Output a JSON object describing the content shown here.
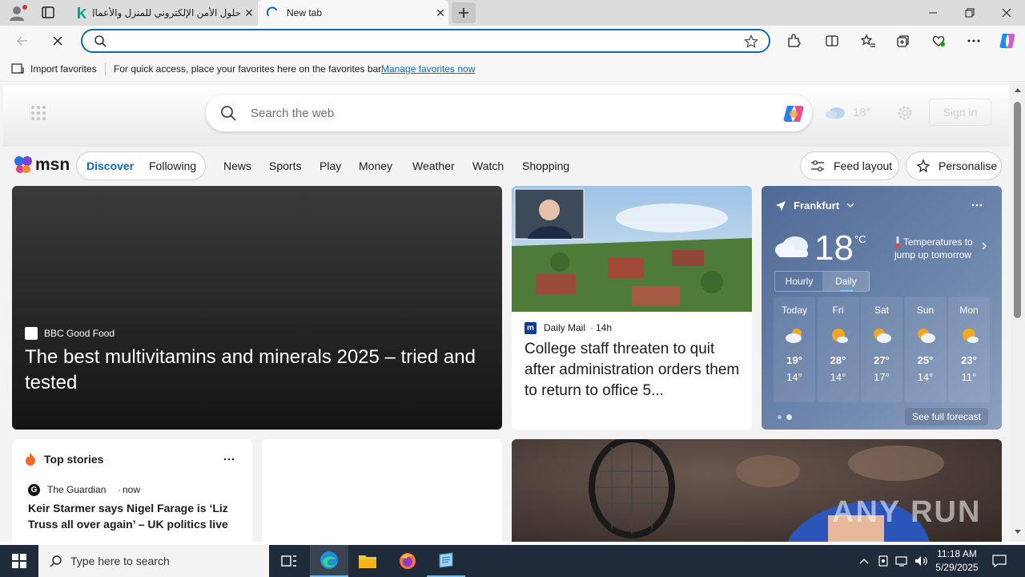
{
  "browser": {
    "tabs": [
      {
        "title": "حلول الأمن الإلكتروني للمنزل والأعمال",
        "icon": "kaspersky-k-icon"
      },
      {
        "title": "New tab",
        "icon": "loading-spinner-icon"
      }
    ],
    "address_value": "",
    "fav_import_label": "Import favorites",
    "fav_message": "For quick access, place your favorites here on the favorites bar.",
    "fav_manage_link": "Manage favorites now"
  },
  "newtab": {
    "search_placeholder": "Search the web",
    "weather_mini_temp": "18°",
    "sign_in_label": "Sign in"
  },
  "msn": {
    "logo_text": "msn",
    "pill_tabs": [
      "Discover",
      "Following"
    ],
    "nav_links": [
      "News",
      "Sports",
      "Play",
      "Money",
      "Weather",
      "Watch",
      "Shopping"
    ],
    "feed_layout_label": "Feed layout",
    "personalise_label": "Personalise"
  },
  "hero_article": {
    "source": "BBC Good Food",
    "headline": "The best multivitamins and minerals 2025 – tried and tested"
  },
  "second_article": {
    "source": "Daily Mail",
    "age": "14h",
    "headline": "College staff threaten to quit after administration orders them to return to office 5..."
  },
  "weather": {
    "location": "Frankfurt",
    "temp": "18",
    "unit": "°C",
    "alert": "Temperatures to jump up tomorrow",
    "toggle": [
      "Hourly",
      "Daily"
    ],
    "days": [
      {
        "day": "Today",
        "high": "19°",
        "low": "14°",
        "icon": "partly-cloudy-icon"
      },
      {
        "day": "Fri",
        "high": "28°",
        "low": "14°",
        "icon": "sunny-cloud-icon"
      },
      {
        "day": "Sat",
        "high": "27°",
        "low": "17°",
        "icon": "sun-cloud-icon"
      },
      {
        "day": "Sun",
        "high": "25°",
        "low": "14°",
        "icon": "sun-cloud-icon"
      },
      {
        "day": "Mon",
        "high": "23°",
        "low": "11°",
        "icon": "sunny-cloud-icon"
      }
    ],
    "see_full_forecast": "See full forecast"
  },
  "top_stories": {
    "title": "Top stories",
    "source": "The Guardian",
    "age": "now",
    "headline": "Keir Starmer says Nigel Farage is ‘Liz Truss all over again’ – UK politics live"
  },
  "taskbar": {
    "search_placeholder": "Type here to search",
    "time": "11:18 AM",
    "date": "5/29/2025"
  },
  "watermark": "ANY RUN"
}
